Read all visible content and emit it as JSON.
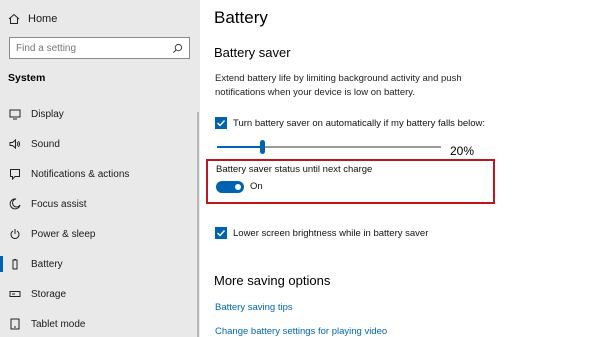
{
  "sidebar": {
    "home_label": "Home",
    "search_placeholder": "Find a setting",
    "section_label": "System",
    "items": [
      {
        "label": "Display",
        "icon": "display-icon"
      },
      {
        "label": "Sound",
        "icon": "sound-icon"
      },
      {
        "label": "Notifications & actions",
        "icon": "notifications-icon"
      },
      {
        "label": "Focus assist",
        "icon": "moon-icon"
      },
      {
        "label": "Power & sleep",
        "icon": "power-icon"
      },
      {
        "label": "Battery",
        "icon": "battery-icon",
        "active": true
      },
      {
        "label": "Storage",
        "icon": "storage-icon"
      },
      {
        "label": "Tablet mode",
        "icon": "tablet-icon"
      }
    ]
  },
  "main": {
    "page_title": "Battery",
    "battery_saver": {
      "title": "Battery saver",
      "description": "Extend battery life by limiting background activity and push notifications when your device is low on battery.",
      "auto_checkbox_label": "Turn battery saver on automatically if my battery falls below:",
      "auto_checkbox_checked": true,
      "threshold_percent": 20,
      "threshold_label": "20%",
      "status_label": "Battery saver status until next charge",
      "status_toggle_on": true,
      "status_toggle_text": "On",
      "brightness_checkbox_label": "Lower screen brightness while in battery saver",
      "brightness_checkbox_checked": true
    },
    "more_options": {
      "title": "More saving options",
      "links": [
        "Battery saving tips",
        "Change battery settings for playing video"
      ]
    }
  },
  "colors": {
    "accent": "#0063b1",
    "link": "#0066b4",
    "highlight_border": "#c0151d",
    "sidebar_bg": "#e9e9e9"
  }
}
